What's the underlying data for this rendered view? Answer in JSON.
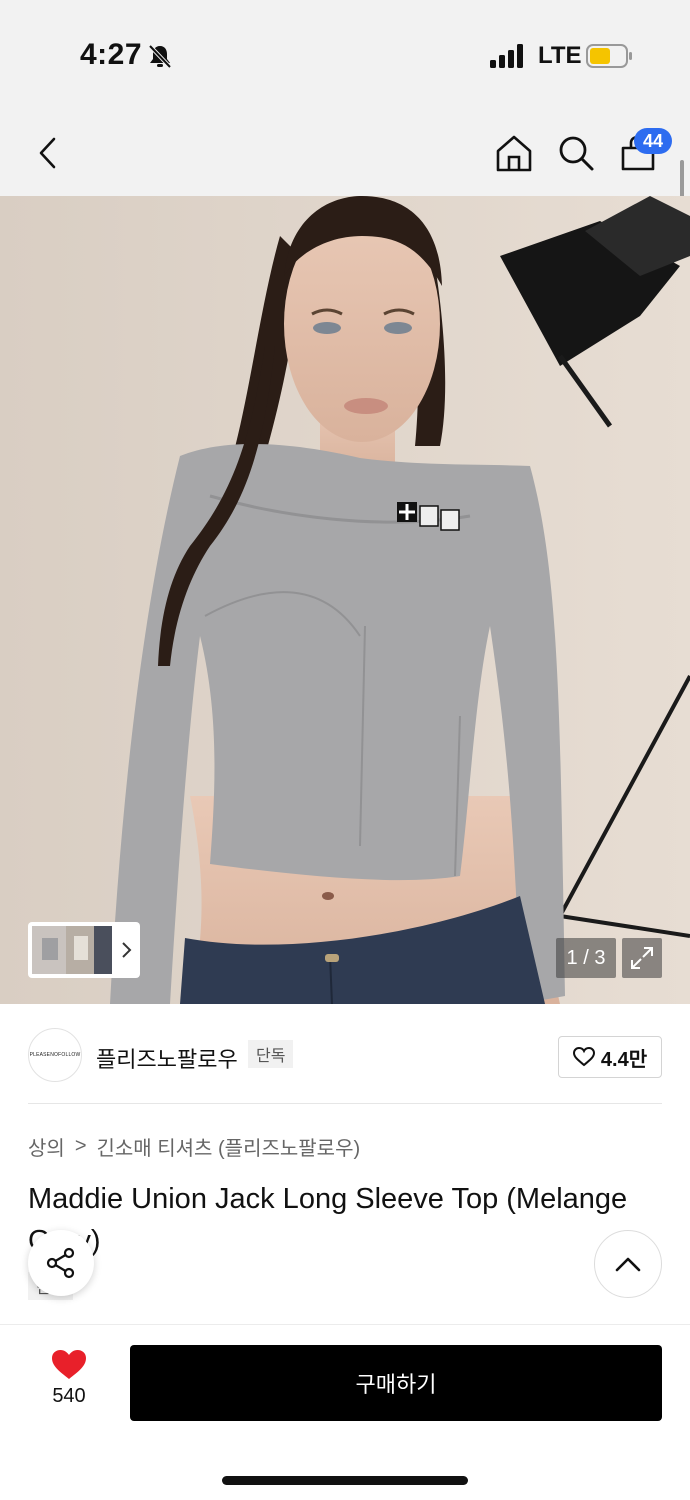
{
  "status_bar": {
    "time": "4:27",
    "network": "LTE",
    "icons": [
      "bell-slash-icon",
      "signal-icon",
      "battery-icon"
    ],
    "battery_color": "#f5c400"
  },
  "nav": {
    "icons": [
      "chevron-left-icon",
      "home-icon",
      "search-icon",
      "cart-icon"
    ],
    "cart_badge": "44",
    "badge_color": "#2d6cf0"
  },
  "gallery": {
    "counter": "1 / 3",
    "icons": [
      "chevron-right-icon",
      "expand-icon"
    ]
  },
  "brand": {
    "logo_text": "PLEASENOFOLLOW",
    "name": "플리즈노팔로우",
    "tag": "단독",
    "likes": "4.4만",
    "icons": [
      "heart-outline-icon"
    ]
  },
  "breadcrumb": {
    "category": "상의",
    "separator": ">",
    "subcategory": "긴소매 티셔츠 (플리즈노팔로우)"
  },
  "product": {
    "title": "Maddie Union Jack Long Sleeve Top (Melange Grey)",
    "tag": "단독"
  },
  "floating": {
    "icons": [
      "share-icon",
      "chevron-up-icon"
    ]
  },
  "bottom_bar": {
    "wish_count": "540",
    "buy_label": "구매하기",
    "heart_color": "#e8202a",
    "icons": [
      "heart-filled-icon"
    ]
  }
}
